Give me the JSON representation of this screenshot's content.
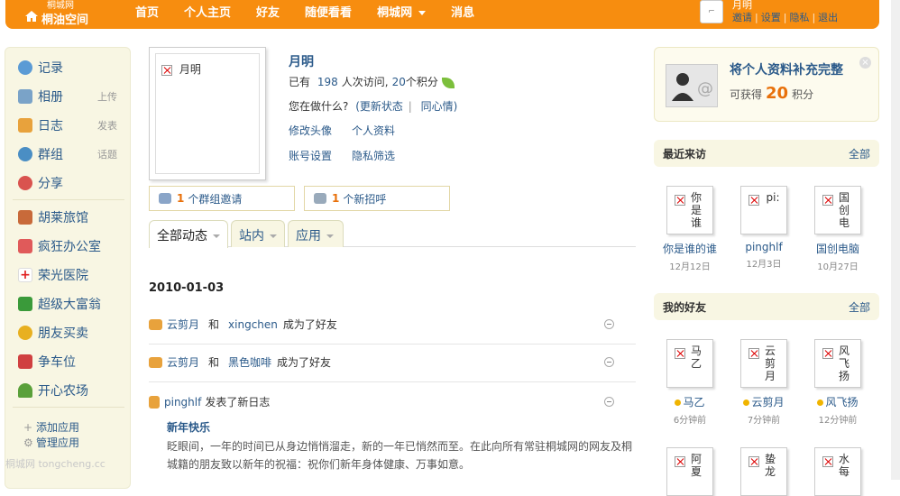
{
  "topbar": {
    "logo_small": "桐城网",
    "logo_big": "桐油空间",
    "nav": [
      "首页",
      "个人主页",
      "好友",
      "随便看看",
      "桐城网",
      "消息"
    ],
    "user_name": "月明",
    "user_links": [
      "邀请",
      "设置",
      "隐私",
      "退出"
    ]
  },
  "sidebar": {
    "items": [
      {
        "label": "记录",
        "sub": "",
        "icon": "record-icon",
        "color": "#5b9bd5"
      },
      {
        "label": "相册",
        "sub": "上传",
        "icon": "album-icon",
        "color": "#7aa3c8"
      },
      {
        "label": "日志",
        "sub": "发表",
        "icon": "blog-icon",
        "color": "#e8a23c"
      },
      {
        "label": "群组",
        "sub": "话题",
        "icon": "group-icon",
        "color": "#4a8ec4"
      },
      {
        "label": "分享",
        "sub": "",
        "icon": "share-icon",
        "color": "#d9534f"
      },
      {
        "label": "胡莱旅馆",
        "sub": "",
        "icon": "hotel-app-icon",
        "color": "#c86a3a"
      },
      {
        "label": "疯狂办公室",
        "sub": "",
        "icon": "office-app-icon",
        "color": "#e05a5a"
      },
      {
        "label": "荣光医院",
        "sub": "",
        "icon": "hospital-app-icon",
        "color": "#e02020"
      },
      {
        "label": "超级大富翁",
        "sub": "",
        "icon": "monopoly-app-icon",
        "color": "#3a9a3a"
      },
      {
        "label": "朋友买卖",
        "sub": "",
        "icon": "trade-app-icon",
        "color": "#e8b020"
      },
      {
        "label": "争车位",
        "sub": "",
        "icon": "parking-app-icon",
        "color": "#d04040"
      },
      {
        "label": "开心农场",
        "sub": "",
        "icon": "farm-app-icon",
        "color": "#5aa03a"
      }
    ],
    "add_app": "添加应用",
    "manage_app": "管理应用"
  },
  "profile": {
    "avatar_alt": "月明",
    "name": "月明",
    "visits_prefix": "已有",
    "visits": "198",
    "visits_suffix": "人次访问,",
    "points": "20",
    "points_suffix": "个积分",
    "status_prompt": "您在做什么?",
    "status_update": "(更新状态",
    "status_mood": "同心情)",
    "links_row1": [
      "修改头像",
      "个人资料"
    ],
    "links_row2": [
      "账号设置",
      "隐私筛选"
    ]
  },
  "invites": {
    "group_count": "1",
    "group_text": "个群组邀请",
    "greet_count": "1",
    "greet_text": "个新招呼"
  },
  "tabs": [
    "全部动态",
    "站内",
    "应用"
  ],
  "feed": {
    "date": "2010-01-03",
    "items": [
      {
        "actor": "云剪月",
        "mid": "和",
        "target": "xingchen",
        "action": "成为了好友"
      },
      {
        "actor": "云剪月",
        "mid": "和",
        "target": "黑色咖啡",
        "action": "成为了好友"
      },
      {
        "actor": "pinghlf",
        "action": "发表了新日志"
      }
    ],
    "blog_title": "新年快乐",
    "blog_body": "眨眼间，一年的时间已从身边悄悄溜走，新的一年已悄然而至。在此向所有常驻桐城网的网友及桐城籍的朋友致以新年的祝福：祝你们新年身体健康、万事如意。"
  },
  "promo": {
    "title": "将个人资料补充完整",
    "gain": "可获得",
    "points": "20",
    "unit": "积分"
  },
  "recent": {
    "title": "最近来访",
    "all": "全部",
    "visitors": [
      {
        "img_text": "你是谁",
        "name": "你是谁的谁",
        "time": "12月12日"
      },
      {
        "img_text": "pi:",
        "name": "pinghlf",
        "time": "12月3日"
      },
      {
        "img_text": "国创电",
        "name": "国创电脑",
        "time": "10月27日"
      }
    ]
  },
  "friends": {
    "title": "我的好友",
    "all": "全部",
    "list": [
      {
        "img_text": "马乙",
        "name": "马乙",
        "time": "6分钟前"
      },
      {
        "img_text": "云剪月",
        "name": "云剪月",
        "time": "7分钟前"
      },
      {
        "img_text": "风飞扬",
        "name": "风飞扬",
        "time": "12分钟前"
      },
      {
        "img_text": "阿夏",
        "name": "",
        "time": ""
      },
      {
        "img_text": "蛰龙",
        "name": "",
        "time": ""
      },
      {
        "img_text": "水每",
        "name": "",
        "time": ""
      }
    ]
  },
  "watermark": "桐城网 tongcheng.cc"
}
